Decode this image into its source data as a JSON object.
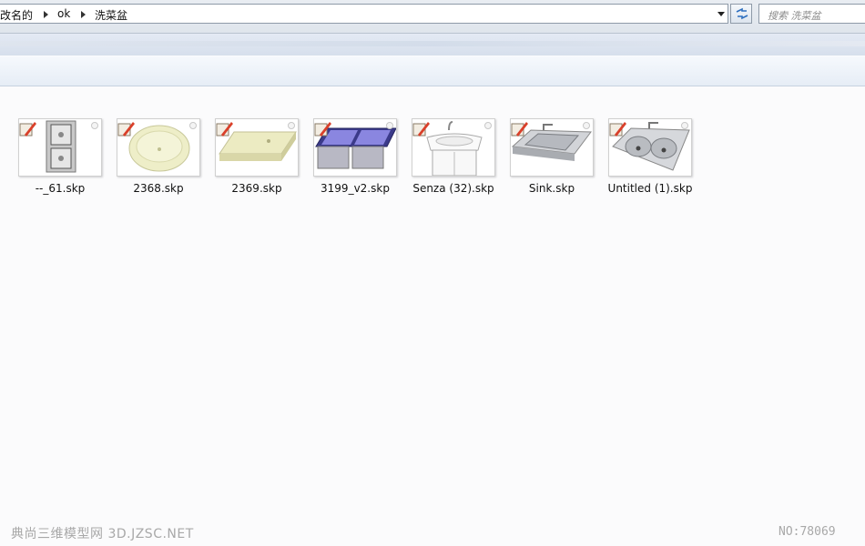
{
  "address_bar": {
    "breadcrumbs": [
      "改名的",
      "ok",
      "洗菜盆"
    ]
  },
  "search": {
    "placeholder": "搜索 洗菜盆"
  },
  "files": [
    {
      "name": "--_61.skp",
      "icon": "double-sink-top-view-thumbnail"
    },
    {
      "name": "2368.skp",
      "icon": "oval-basin-thumbnail"
    },
    {
      "name": "2369.skp",
      "icon": "rectangular-basin-thumbnail"
    },
    {
      "name": "3199_v2.skp",
      "icon": "purple-double-sink-thumbnail"
    },
    {
      "name": "Senza (32).skp",
      "icon": "pedestal-sink-cabinet-thumbnail"
    },
    {
      "name": "Sink.skp",
      "icon": "single-steel-sink-thumbnail"
    },
    {
      "name": "Untitled (1).skp",
      "icon": "double-steel-sink-faucet-thumbnail"
    }
  ],
  "watermark": {
    "left": "典尚三维模型网 3D.JZSC.NET",
    "right": "NO:78069"
  },
  "colors": {
    "window_bg": "#fbfbfc",
    "toolbar_band": "#d6dfec",
    "sketchup_red": "#d9402a"
  }
}
